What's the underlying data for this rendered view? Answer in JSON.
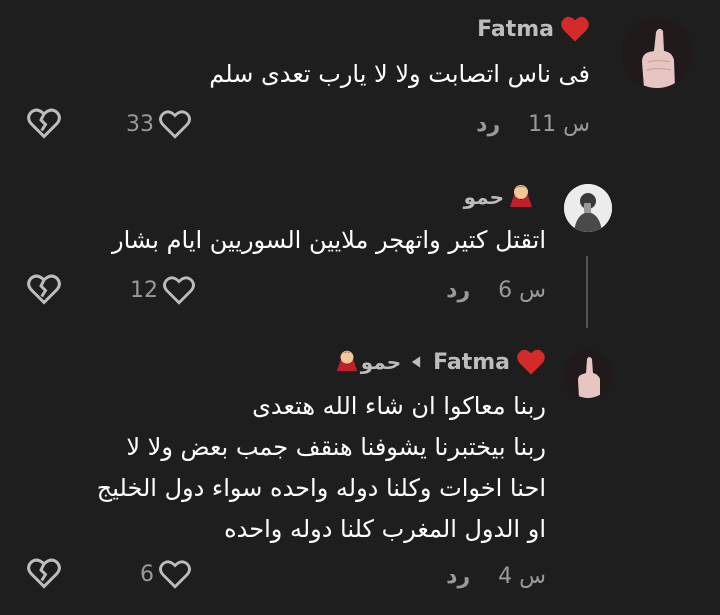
{
  "comments": [
    {
      "name": "Fatma",
      "text": "فى ناس اتصابت ولا لا يارب تعدى سلم",
      "time": "11 س",
      "reply_label": "رد",
      "likes": "33",
      "heart_color": "#d62a2a"
    },
    {
      "name": "حمو",
      "text": "اتقتل كتير واتهجر ملايين السوريين ايام بشار",
      "time": "6 س",
      "reply_label": "رد",
      "likes": "12"
    },
    {
      "name": "Fatma",
      "reply_to": "حمو",
      "text_lines": [
        "ربنا معاكوا ان شاء الله هتعدى",
        "ربنا بيختبرنا يشوفنا هنقف جمب بعض ولا لا",
        "احنا اخوات وكلنا دوله واحده سواء دول الخليج",
        "او الدول المغرب كلنا دوله واحده"
      ],
      "time": "4 س",
      "reply_label": "رد",
      "likes": "6"
    }
  ]
}
